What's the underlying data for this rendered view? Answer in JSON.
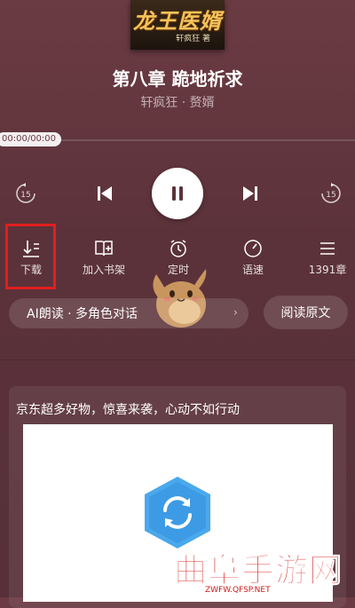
{
  "cover": {
    "title": "龙王医婿",
    "author": "轩疯狂 著"
  },
  "chapter": {
    "title": "第八章 跪地祈求",
    "subtitle": "轩疯狂 · 赘婿"
  },
  "player": {
    "time": "00:00/00:00",
    "progress": 0,
    "rewind_seconds": "15",
    "forward_seconds": "15"
  },
  "tools": [
    {
      "label": "下载",
      "icon": "download-icon"
    },
    {
      "label": "加入书架",
      "icon": "bookshelf-icon"
    },
    {
      "label": "定时",
      "icon": "alarm-clock-icon"
    },
    {
      "label": "语速",
      "icon": "speed-icon"
    },
    {
      "label": "1391章",
      "icon": "list-icon"
    }
  ],
  "ai_reading": {
    "label": "AI朗读 · 多角色对话",
    "arrow": "›"
  },
  "read_original": {
    "label": "阅读原文"
  },
  "ad": {
    "text": "京东超多好物，惊喜来袭，心动不如行动"
  },
  "watermark": {
    "text": "曲阜手游网",
    "url": "ZWFW.QFSP.NET"
  },
  "colors": {
    "background": "#5c323a",
    "highlight": "#e01e1e",
    "ad_logo": "#3fa8f0"
  }
}
